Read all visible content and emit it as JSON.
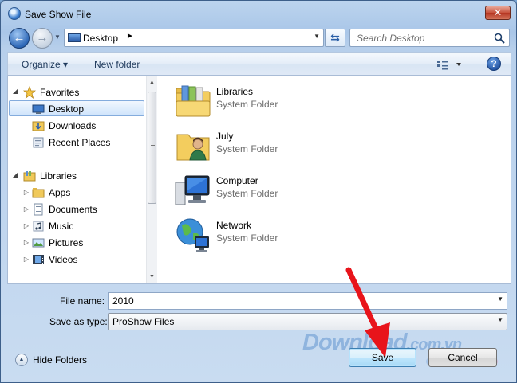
{
  "window": {
    "title": "Save Show File",
    "close_label": "✕"
  },
  "nav": {
    "address_path": "Desktop",
    "search_placeholder": "Search Desktop"
  },
  "toolbar": {
    "organize_label": "Organize ▾",
    "new_folder_label": "New folder",
    "help_label": "?"
  },
  "sidebar": {
    "favorites": {
      "label": "Favorites",
      "items": [
        {
          "label": "Desktop",
          "icon": "desktop-icon",
          "selected": true
        },
        {
          "label": "Downloads",
          "icon": "downloads-folder-icon"
        },
        {
          "label": "Recent Places",
          "icon": "recent-places-icon"
        }
      ]
    },
    "libraries": {
      "label": "Libraries",
      "items": [
        {
          "label": "Apps",
          "icon": "apps-folder-icon"
        },
        {
          "label": "Documents",
          "icon": "documents-icon"
        },
        {
          "label": "Music",
          "icon": "music-icon"
        },
        {
          "label": "Pictures",
          "icon": "pictures-icon"
        },
        {
          "label": "Videos",
          "icon": "videos-icon"
        }
      ]
    }
  },
  "files": [
    {
      "name": "Libraries",
      "type": "System Folder",
      "icon": "libraries-icon"
    },
    {
      "name": "July",
      "type": "System Folder",
      "icon": "user-folder-icon"
    },
    {
      "name": "Computer",
      "type": "System Folder",
      "icon": "computer-icon"
    },
    {
      "name": "Network",
      "type": "System Folder",
      "icon": "network-icon"
    }
  ],
  "form": {
    "file_name_label": "File name:",
    "file_name_value": "2010",
    "save_as_type_label": "Save as type:",
    "save_as_type_value": "ProShow Files"
  },
  "footer": {
    "hide_folders_label": "Hide Folders",
    "save_label": "Save",
    "cancel_label": "Cancel"
  },
  "watermark": {
    "brand": "Download",
    "suffix": ".com.vn"
  },
  "colors": {
    "selection_border": "#84acdd",
    "annotation_arrow": "#e8141b"
  }
}
